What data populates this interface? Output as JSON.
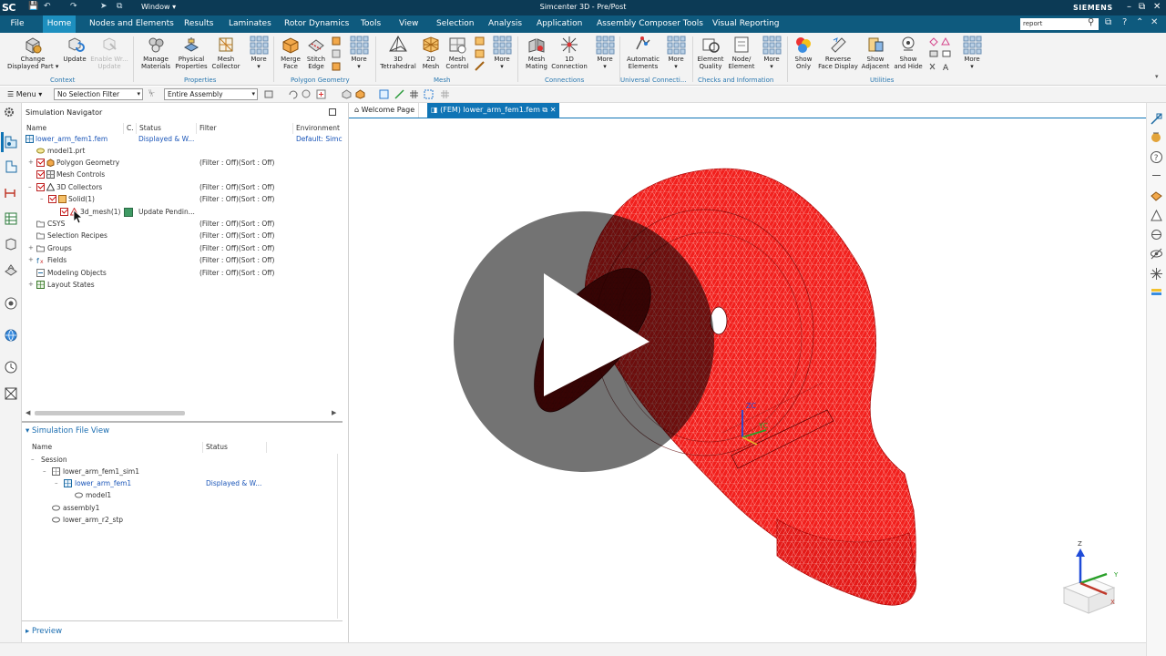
{
  "titlebar": {
    "logo": "SC",
    "window_menu": "Window",
    "title": "Simcenter 3D - Pre/Post",
    "brand": "SIEMENS"
  },
  "menubar": {
    "tabs": [
      "File",
      "Home",
      "Nodes and Elements",
      "Results",
      "Laminates",
      "Rotor Dynamics",
      "Tools",
      "View",
      "Selection",
      "Analysis",
      "Application",
      "Assembly Composer Tools",
      "Visual Reporting"
    ],
    "active_tab": "Home",
    "search_value": "report"
  },
  "ribbon": {
    "buttons": [
      {
        "label1": "Change",
        "label2": "Displayed Part",
        "icon": "change-part-icon"
      },
      {
        "label1": "Update",
        "label2": "",
        "icon": "update-icon"
      },
      {
        "label1": "Enable Wr...",
        "label2": "Update",
        "icon": "enable-write-icon",
        "disabled": true
      },
      {
        "label1": "Manage",
        "label2": "Materials",
        "icon": "materials-icon"
      },
      {
        "label1": "Physical",
        "label2": "Properties",
        "icon": "physical-properties-icon"
      },
      {
        "label1": "Mesh",
        "label2": "Collector",
        "icon": "mesh-collector-icon"
      },
      {
        "label1": "More",
        "label2": "",
        "icon": "more-grid-icon"
      },
      {
        "label1": "Merge",
        "label2": "Face",
        "icon": "merge-face-icon"
      },
      {
        "label1": "Stitch",
        "label2": "Edge",
        "icon": "stitch-edge-icon"
      },
      {
        "label1": "More",
        "label2": "",
        "icon": "more-grid-icon"
      },
      {
        "label1": "3D",
        "label2": "Tetrahedral",
        "icon": "tetra-icon"
      },
      {
        "label1": "2D",
        "label2": "Mesh",
        "icon": "2d-mesh-icon"
      },
      {
        "label1": "Mesh",
        "label2": "Control",
        "icon": "mesh-control-icon"
      },
      {
        "label1": "More",
        "label2": "",
        "icon": "more-grid-icon"
      },
      {
        "label1": "Mesh",
        "label2": "Mating",
        "icon": "mesh-mating-icon"
      },
      {
        "label1": "1D",
        "label2": "Connection",
        "icon": "1d-connection-icon"
      },
      {
        "label1": "More",
        "label2": "",
        "icon": "more-grid-icon"
      },
      {
        "label1": "Automatic",
        "label2": "Elements",
        "icon": "automatic-elements-icon"
      },
      {
        "label1": "More",
        "label2": "",
        "icon": "more-grid-icon"
      },
      {
        "label1": "Element",
        "label2": "Quality",
        "icon": "element-quality-icon"
      },
      {
        "label1": "Node/",
        "label2": "Element",
        "icon": "node-element-icon"
      },
      {
        "label1": "More",
        "label2": "",
        "icon": "more-grid-icon"
      },
      {
        "label1": "Show",
        "label2": "Only",
        "icon": "show-only-icon"
      },
      {
        "label1": "Reverse",
        "label2": "Face Display",
        "icon": "reverse-face-icon"
      },
      {
        "label1": "Show",
        "label2": "Adjacent",
        "icon": "show-adjacent-icon"
      },
      {
        "label1": "Show",
        "label2": "and Hide",
        "icon": "show-hide-icon"
      },
      {
        "label1": "More",
        "label2": "",
        "icon": "more-grid-icon"
      }
    ],
    "groups": [
      "Context",
      "Properties",
      "Polygon Geometry",
      "Mesh",
      "Connections",
      "Universal Connecti...",
      "Checks and Information",
      "Utilities"
    ]
  },
  "selbar": {
    "menu_label": "Menu",
    "filter_value": "No Selection Filter",
    "scope_value": "Entire Assembly"
  },
  "navigator": {
    "title": "Simulation Navigator",
    "columns": [
      "Name",
      "C.",
      "Status",
      "Filter",
      "Environment"
    ],
    "rows": [
      {
        "name": "lower_arm_fem1.fem",
        "status": "Displayed & W...",
        "filter": "",
        "env": "Default: Simc"
      },
      {
        "name": "model1.prt",
        "status": "",
        "filter": "",
        "env": ""
      },
      {
        "name": "Polygon Geometry",
        "status": "",
        "filter": "(Filter : Off)(Sort : Off)",
        "env": ""
      },
      {
        "name": "Mesh Controls",
        "status": "",
        "filter": "",
        "env": ""
      },
      {
        "name": "3D Collectors",
        "status": "",
        "filter": "(Filter : Off)(Sort : Off)",
        "env": ""
      },
      {
        "name": "Solid(1)",
        "status": "",
        "filter": "(Filter : Off)(Sort : Off)",
        "env": ""
      },
      {
        "name": "3d_mesh(1)",
        "status": "Update Pendin...",
        "filter": "",
        "env": ""
      },
      {
        "name": "CSYS",
        "status": "",
        "filter": "(Filter : Off)(Sort : Off)",
        "env": ""
      },
      {
        "name": "Selection Recipes",
        "status": "",
        "filter": "(Filter : Off)(Sort : Off)",
        "env": ""
      },
      {
        "name": "Groups",
        "status": "",
        "filter": "(Filter : Off)(Sort : Off)",
        "env": ""
      },
      {
        "name": "Fields",
        "status": "",
        "filter": "(Filter : Off)(Sort : Off)",
        "env": ""
      },
      {
        "name": "Modeling Objects",
        "status": "",
        "filter": "(Filter : Off)(Sort : Off)",
        "env": ""
      },
      {
        "name": "Layout States",
        "status": "",
        "filter": "",
        "env": ""
      }
    ]
  },
  "fileview": {
    "title": "Simulation File View",
    "columns": [
      "Name",
      "Status"
    ],
    "rows": [
      {
        "name": "Session",
        "status": ""
      },
      {
        "name": "lower_arm_fem1_sim1",
        "status": ""
      },
      {
        "name": "lower_arm_fem1",
        "status": "Displayed & W..."
      },
      {
        "name": "model1",
        "status": ""
      },
      {
        "name": "assembly1",
        "status": ""
      },
      {
        "name": "lower_arm_r2_stp",
        "status": ""
      }
    ]
  },
  "preview": {
    "title": "Preview"
  },
  "viewport": {
    "tabs": [
      "Welcome Page",
      "(FEM) lower_arm_fem1.fem"
    ],
    "triad": {
      "z": "Z",
      "y": "Y",
      "x": "X"
    },
    "wcs": {
      "z": "ZC",
      "y": "YC"
    }
  },
  "colors": {
    "mesh_red": "#f2201d",
    "title_bar": "#0c3a55",
    "menu_bar": "#0e5a7e",
    "active_tab": "#1d8fbf",
    "link_blue": "#1a55b8"
  }
}
